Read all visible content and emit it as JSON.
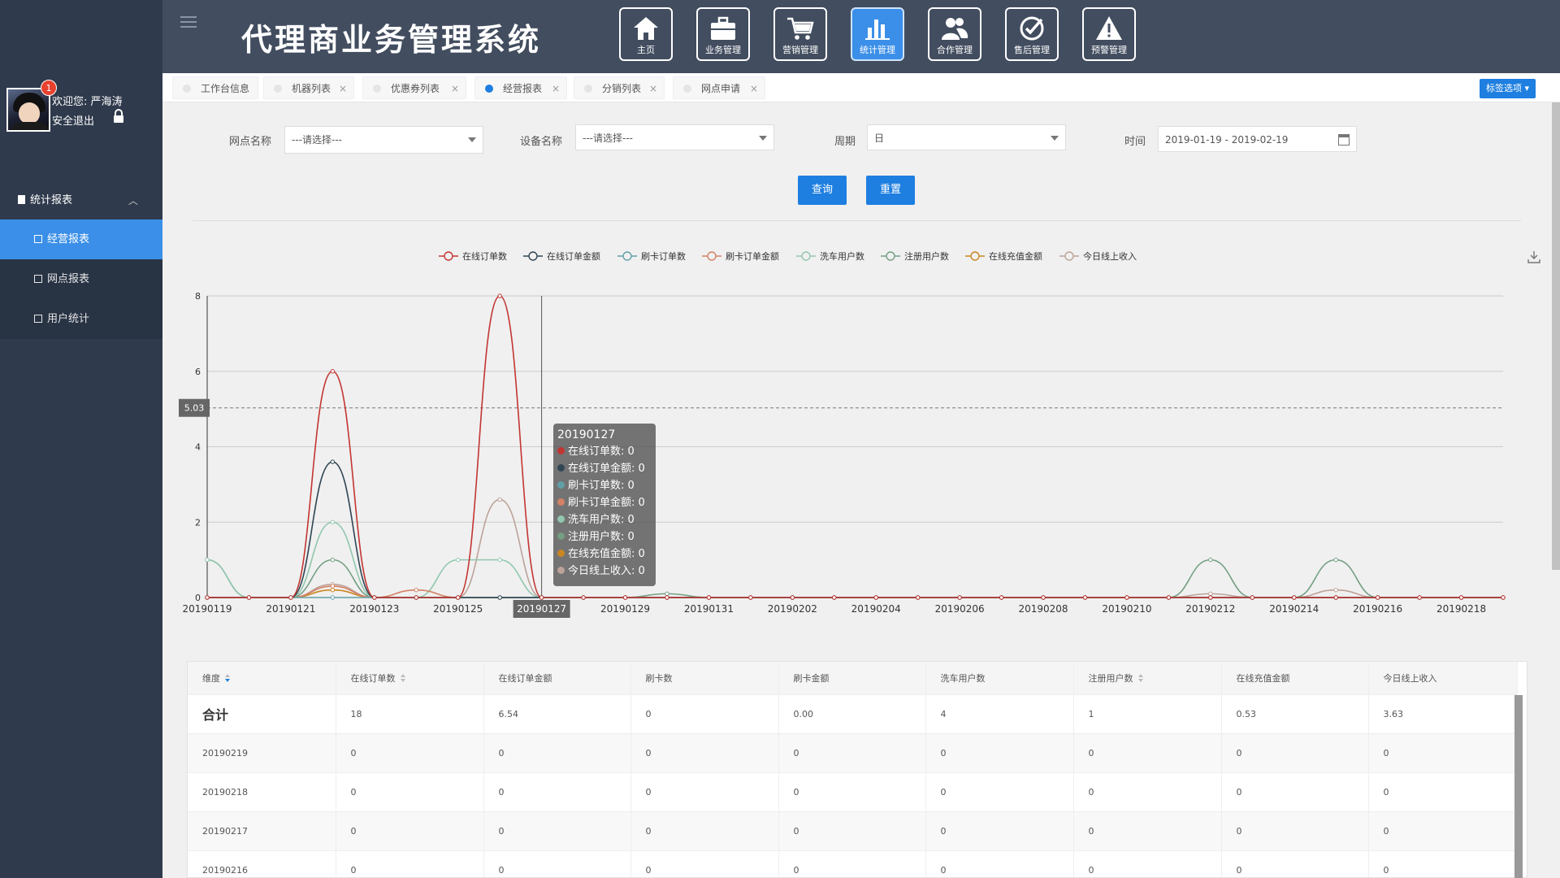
{
  "user": {
    "badge_count": "1",
    "welcome_text": "欢迎您:  严海涛",
    "logout_text": "安全退出"
  },
  "sidebar": {
    "group_label": "统计报表",
    "items": [
      {
        "label": "经营报表",
        "active": true
      },
      {
        "label": "网点报表",
        "active": false
      },
      {
        "label": "用户统计",
        "active": false
      }
    ]
  },
  "header": {
    "title": "代理商业务管理系统",
    "nav": [
      {
        "label": "主页",
        "icon": "home-icon",
        "active": false
      },
      {
        "label": "业务管理",
        "icon": "briefcase-icon",
        "active": false
      },
      {
        "label": "营销管理",
        "icon": "cart-icon",
        "active": false
      },
      {
        "label": "统计管理",
        "icon": "bar-chart-icon",
        "active": true
      },
      {
        "label": "合作管理",
        "icon": "users-icon",
        "active": false
      },
      {
        "label": "售后管理",
        "icon": "check-circle-icon",
        "active": false
      },
      {
        "label": "预警管理",
        "icon": "warning-icon",
        "active": false
      }
    ]
  },
  "tabs": {
    "items": [
      {
        "label": "工作台信息",
        "closable": false,
        "active": false
      },
      {
        "label": "机器列表",
        "closable": true,
        "active": false
      },
      {
        "label": "优惠券列表",
        "closable": true,
        "active": false
      },
      {
        "label": "经营报表",
        "closable": true,
        "active": true
      },
      {
        "label": "分销列表",
        "closable": true,
        "active": false
      },
      {
        "label": "网点申请",
        "closable": true,
        "active": false
      }
    ],
    "close_glyph": "×",
    "options_label": "标签选项 ▾"
  },
  "filters": {
    "outlet_label": "网点名称",
    "outlet_value": "---请选择---",
    "device_label": "设备名称",
    "device_value": "---请选择---",
    "period_label": "周期",
    "period_value": "日",
    "time_label": "时间",
    "time_value": "2019-01-19 - 2019-02-19",
    "query_label": "查询",
    "reset_label": "重置"
  },
  "chart_data": {
    "type": "line",
    "x": [
      "20190119",
      "20190120",
      "20190121",
      "20190122",
      "20190123",
      "20190124",
      "20190125",
      "20190126",
      "20190127",
      "20190128",
      "20190129",
      "20190130",
      "20190131",
      "20190201",
      "20190202",
      "20190203",
      "20190204",
      "20190205",
      "20190206",
      "20190207",
      "20190208",
      "20190209",
      "20190210",
      "20190211",
      "20190212",
      "20190213",
      "20190214",
      "20190215",
      "20190216",
      "20190217",
      "20190218",
      "20190219"
    ],
    "x_tick_labels": [
      "20190119",
      "20190121",
      "20190123",
      "20190125",
      "20190127",
      "20190129",
      "20190131",
      "20190202",
      "20190204",
      "20190206",
      "20190208",
      "20190210",
      "20190212",
      "20190214",
      "20190216",
      "20190218"
    ],
    "ylim": [
      0,
      8
    ],
    "y_ticks": [
      0,
      2,
      4,
      6,
      8
    ],
    "grid": true,
    "legend_position": "top",
    "reference_line": 5.03,
    "reference_label": "5.03",
    "pointer_x_label": "20190127",
    "series": [
      {
        "name": "在线订单数",
        "color": "#c23531",
        "values": [
          0,
          0,
          0,
          6,
          0,
          0,
          0,
          8,
          0,
          0,
          0,
          0,
          0,
          0,
          0,
          0,
          0,
          0,
          0,
          0,
          0,
          0,
          0,
          0,
          0,
          0,
          0,
          0,
          0,
          0,
          0,
          0
        ]
      },
      {
        "name": "在线订单金额",
        "color": "#2f4554",
        "values": [
          0,
          0,
          0,
          3.6,
          0,
          0,
          0,
          0,
          0,
          0,
          0,
          0,
          0,
          0,
          0,
          0,
          0,
          0,
          0,
          0,
          0,
          0,
          0,
          0,
          0,
          0,
          0,
          0,
          0,
          0,
          0,
          0
        ]
      },
      {
        "name": "刷卡订单数",
        "color": "#61a0a8",
        "values": [
          0,
          0,
          0,
          0,
          0,
          0,
          0,
          0,
          0,
          0,
          0,
          0,
          0,
          0,
          0,
          0,
          0,
          0,
          0,
          0,
          0,
          0,
          0,
          0,
          0,
          0,
          0,
          0,
          0,
          0,
          0,
          0
        ]
      },
      {
        "name": "刷卡订单金额",
        "color": "#d48265",
        "values": [
          0,
          0,
          0,
          0.3,
          0,
          0.2,
          0,
          0,
          0,
          0,
          0,
          0,
          0,
          0,
          0,
          0,
          0,
          0,
          0,
          0,
          0,
          0,
          0,
          0,
          0,
          0,
          0,
          0,
          0,
          0,
          0,
          0
        ]
      },
      {
        "name": "洗车用户数",
        "color": "#91c7ae",
        "values": [
          1,
          0,
          0,
          2,
          0,
          0,
          1,
          1,
          0,
          0,
          0,
          0,
          0,
          0,
          0,
          0,
          0,
          0,
          0,
          0,
          0,
          0,
          0,
          0,
          0,
          0,
          0,
          0,
          0,
          0,
          0,
          0
        ]
      },
      {
        "name": "注册用户数",
        "color": "#749f83",
        "values": [
          1,
          0,
          0,
          1,
          0,
          0,
          0,
          0,
          0,
          0,
          0,
          0.1,
          0,
          0,
          0,
          0,
          0,
          0,
          0,
          0,
          0,
          0,
          0,
          0,
          1,
          0,
          0,
          1,
          0,
          0,
          0,
          0
        ]
      },
      {
        "name": "在线充值金额",
        "color": "#ca8622",
        "values": [
          0,
          0,
          0,
          0.2,
          0,
          0,
          0,
          0,
          0,
          0,
          0,
          0,
          0,
          0,
          0,
          0,
          0,
          0,
          0,
          0,
          0,
          0,
          0,
          0,
          0,
          0,
          0,
          0,
          0,
          0,
          0,
          0
        ]
      },
      {
        "name": "今日线上收入",
        "color": "#bda29a",
        "values": [
          0,
          0,
          0,
          0.35,
          0,
          0,
          0,
          2.6,
          0,
          0,
          0,
          0,
          0,
          0,
          0,
          0,
          0,
          0,
          0,
          0,
          0,
          0,
          0,
          0,
          0.1,
          0,
          0,
          0.2,
          0,
          0,
          0,
          0
        ]
      }
    ],
    "tooltip": {
      "title": "20190127",
      "rows": [
        "在线订单数: 0",
        "在线订单金额: 0",
        "刷卡订单数: 0",
        "刷卡订单金额: 0",
        "洗车用户数: 0",
        "注册用户数: 0",
        "在线充值金额: 0",
        "今日线上收入: 0"
      ]
    }
  },
  "table": {
    "headers": [
      "维度",
      "在线订单数",
      "在线订单金额",
      "刷卡数",
      "刷卡金额",
      "洗车用户数",
      "注册用户数",
      "在线充值金额",
      "今日线上收入"
    ],
    "sortable": [
      true,
      true,
      false,
      false,
      false,
      false,
      true,
      false,
      false
    ],
    "rows": [
      [
        "合计",
        "18",
        "6.54",
        "0",
        "0.00",
        "4",
        "1",
        "0.53",
        "3.63"
      ],
      [
        "20190219",
        "0",
        "0",
        "0",
        "0",
        "0",
        "0",
        "0",
        "0"
      ],
      [
        "20190218",
        "0",
        "0",
        "0",
        "0",
        "0",
        "0",
        "0",
        "0"
      ],
      [
        "20190217",
        "0",
        "0",
        "0",
        "0",
        "0",
        "0",
        "0",
        "0"
      ],
      [
        "20190216",
        "0",
        "0",
        "0",
        "0",
        "0",
        "0",
        "0",
        "0"
      ]
    ]
  }
}
